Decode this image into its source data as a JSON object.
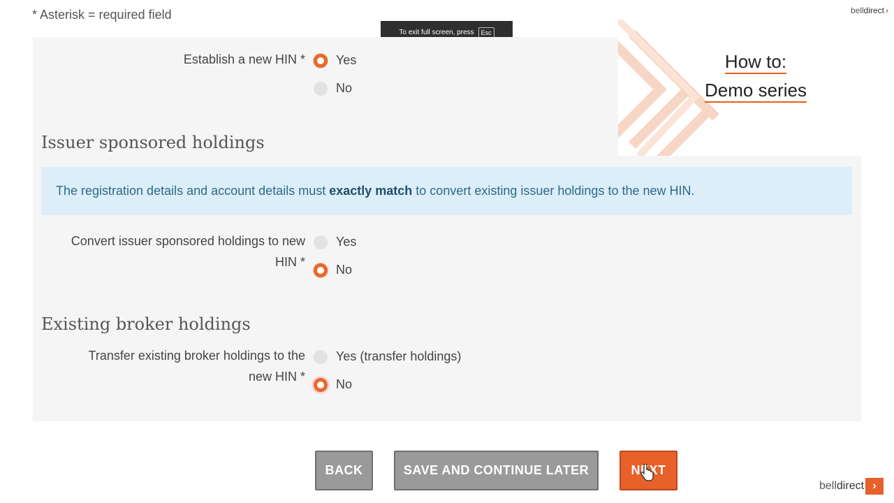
{
  "required_note": "* Asterisk = required field",
  "fullscreen_toast": {
    "text": "To exit full screen, press",
    "key": "Esc"
  },
  "brand": {
    "part1": "bell",
    "part2": "direct",
    "arrow": "›"
  },
  "promo": {
    "line1": "How to:",
    "line2": "Demo series"
  },
  "hin": {
    "label": "Establish a new HIN *",
    "options": [
      {
        "label": "Yes",
        "selected": true
      },
      {
        "label": "No",
        "selected": false
      }
    ]
  },
  "issuer": {
    "title": "Issuer sponsored holdings",
    "info_pre": "The registration details and account details must ",
    "info_bold": "exactly match",
    "info_post": " to convert existing issuer holdings to the new HIN.",
    "label_line1": "Convert issuer sponsored holdings to new",
    "label_line2": "HIN *",
    "options": [
      {
        "label": "Yes",
        "selected": false
      },
      {
        "label": "No",
        "selected": true
      }
    ]
  },
  "broker": {
    "title": "Existing broker holdings",
    "label_line1": "Transfer existing broker holdings to the",
    "label_line2": "new HIN *",
    "options": [
      {
        "label": "Yes (transfer holdings)",
        "selected": false
      },
      {
        "label": "No",
        "selected": true
      }
    ]
  },
  "buttons": {
    "back": "BACK",
    "save": "SAVE AND CONTINUE LATER",
    "next": "NEXT"
  },
  "colors": {
    "accent": "#e8602a",
    "info_bg": "#dceefa",
    "panel_bg": "#f5f5f5"
  }
}
